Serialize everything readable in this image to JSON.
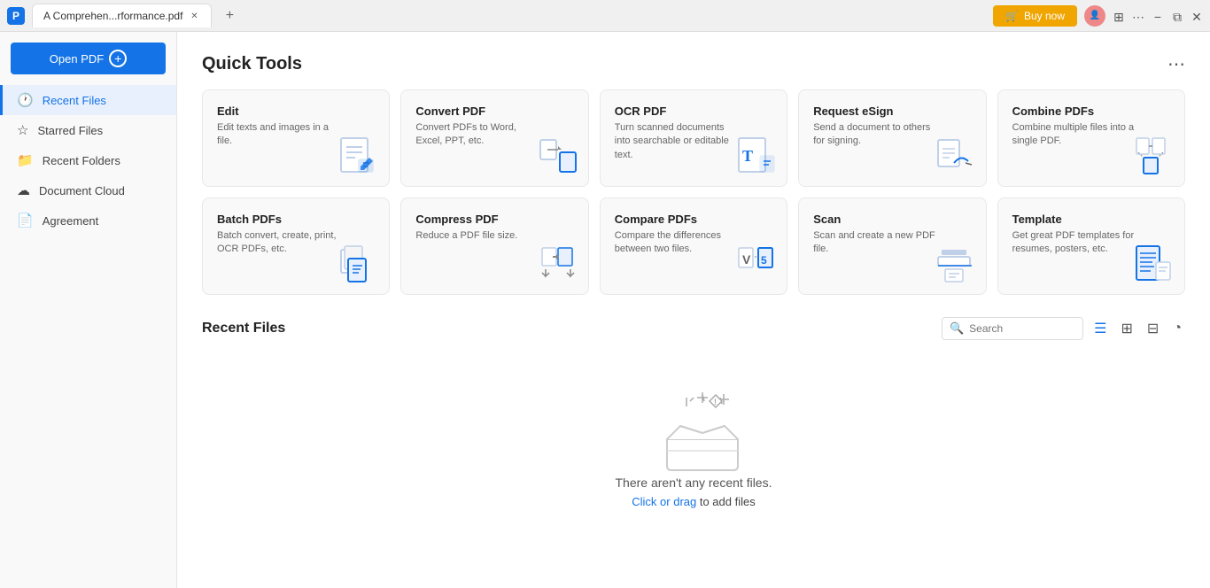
{
  "titlebar": {
    "app_icon_label": "P",
    "tab_label": "A Comprehen...rformance.pdf",
    "buy_now_label": "Buy now",
    "window_minimize": "−",
    "window_restore": "⧉",
    "window_close": "✕",
    "tab_close": "✕",
    "tab_add": "+"
  },
  "sidebar": {
    "open_pdf_label": "Open PDF",
    "plus_label": "+",
    "items": [
      {
        "id": "recent-files",
        "label": "Recent Files",
        "icon": "🕐",
        "active": true
      },
      {
        "id": "starred-files",
        "label": "Starred Files",
        "icon": "☆",
        "active": false
      },
      {
        "id": "recent-folders",
        "label": "Recent Folders",
        "icon": "📁",
        "active": false
      },
      {
        "id": "document-cloud",
        "label": "Document Cloud",
        "icon": "☁",
        "active": false
      },
      {
        "id": "agreement",
        "label": "Agreement",
        "icon": "📄",
        "active": false
      }
    ]
  },
  "main": {
    "quick_tools_title": "Quick Tools",
    "more_icon": "⋯",
    "tools": [
      {
        "id": "edit",
        "title": "Edit",
        "desc": "Edit texts and images in a file."
      },
      {
        "id": "convert-pdf",
        "title": "Convert PDF",
        "desc": "Convert PDFs to Word, Excel, PPT, etc."
      },
      {
        "id": "ocr-pdf",
        "title": "OCR PDF",
        "desc": "Turn scanned documents into searchable or editable text."
      },
      {
        "id": "request-esign",
        "title": "Request eSign",
        "desc": "Send a document to others for signing."
      },
      {
        "id": "combine-pdfs",
        "title": "Combine PDFs",
        "desc": "Combine multiple files into a single PDF."
      },
      {
        "id": "batch-pdfs",
        "title": "Batch PDFs",
        "desc": "Batch convert, create, print, OCR PDFs, etc."
      },
      {
        "id": "compress-pdf",
        "title": "Compress PDF",
        "desc": "Reduce a PDF file size."
      },
      {
        "id": "compare-pdfs",
        "title": "Compare PDFs",
        "desc": "Compare the differences between two files."
      },
      {
        "id": "scan",
        "title": "Scan",
        "desc": "Scan and create a new PDF file."
      },
      {
        "id": "template",
        "title": "Template",
        "desc": "Get great PDF templates for resumes, posters, etc."
      }
    ],
    "recent_files_title": "Recent Files",
    "search_placeholder": "Search",
    "empty_state_text": "There aren't any recent files.",
    "empty_state_link_text": "Click or drag",
    "empty_state_link_suffix": " to add files"
  }
}
